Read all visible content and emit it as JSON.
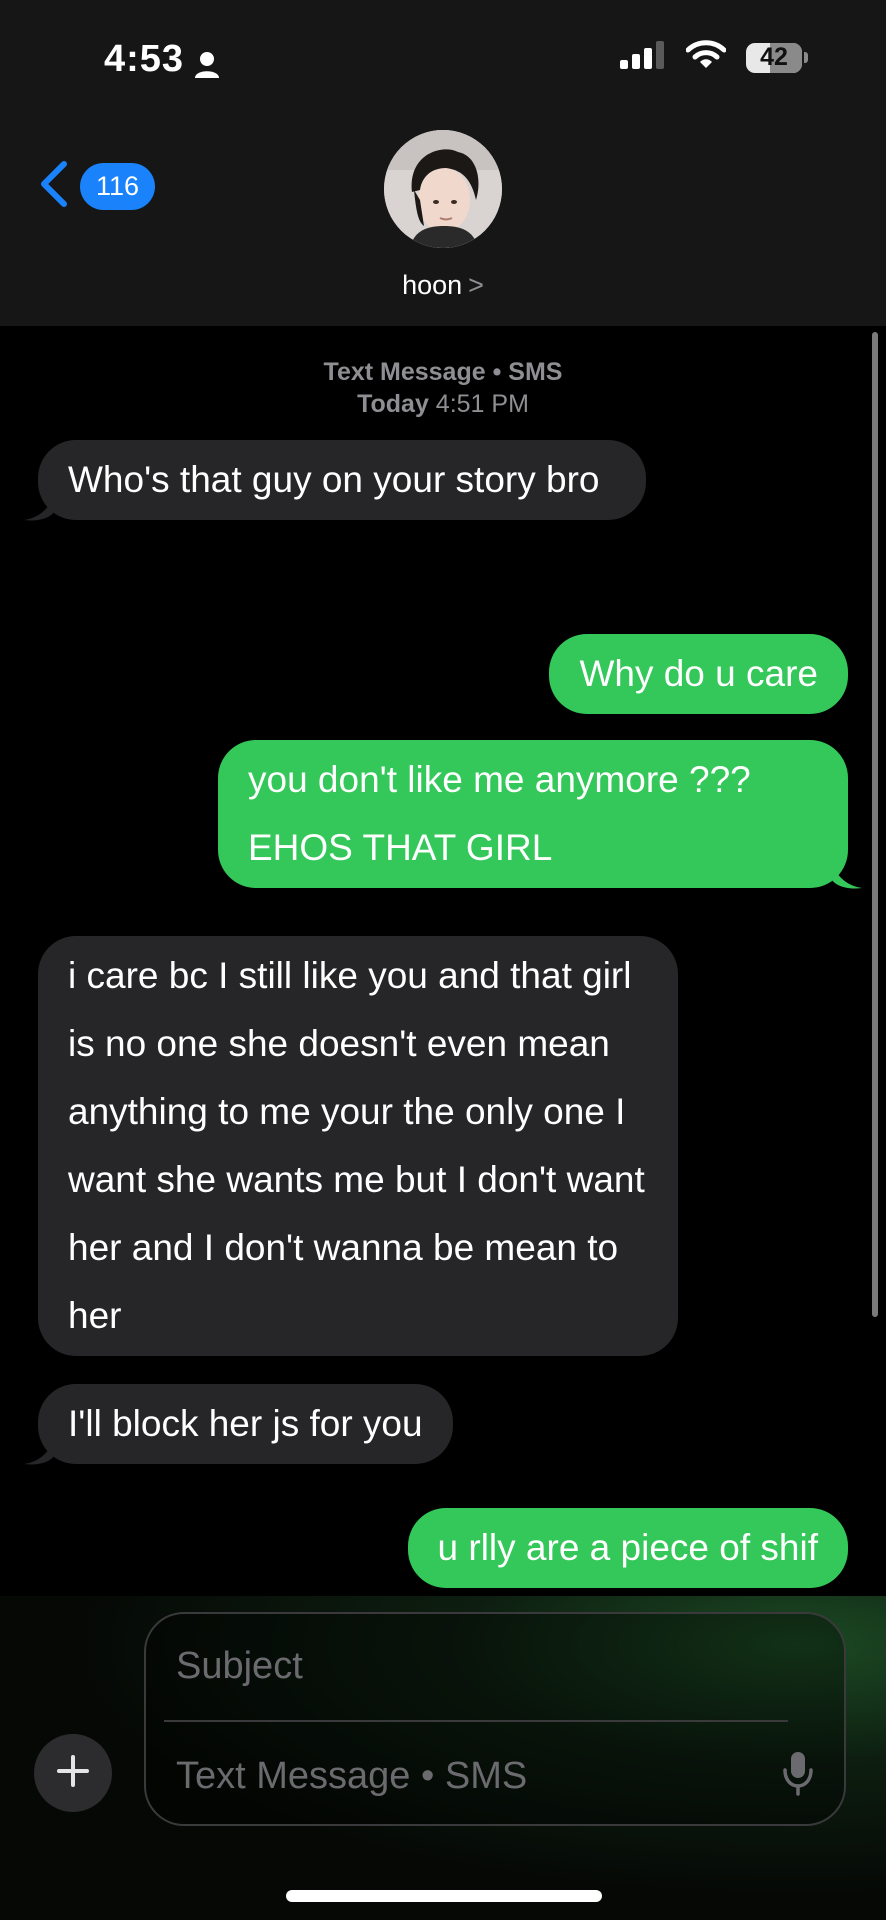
{
  "status_bar": {
    "time": "4:53",
    "battery": "42",
    "battery_level": 0.42
  },
  "nav": {
    "back_count": "116",
    "contact_name": "hoon",
    "contact_chevron": ">"
  },
  "conversation": {
    "service_label": "Text Message • SMS",
    "date_prefix": "Today",
    "date_time": "4:51 PM",
    "messages": [
      {
        "direction": "in",
        "text": "Who's that guy on your story bro"
      },
      {
        "direction": "out",
        "text": "Why do u care"
      },
      {
        "direction": "out",
        "text": "you don't like me anymore ??? EHOS THAT GIRL"
      },
      {
        "direction": "in",
        "text": "i care bc I still like you and that girl is no one she doesn't even mean anything to me your the only one I want she wants me but I don't want her and I don't wanna be mean to her"
      },
      {
        "direction": "in",
        "text": "I'll block her js for you"
      },
      {
        "direction": "out",
        "text": "u rlly are a piece of shif"
      }
    ]
  },
  "composer": {
    "subject_placeholder": "Subject",
    "message_placeholder": "Text Message • SMS"
  },
  "colors": {
    "sent_bubble": "#34c759",
    "received_bubble": "#262628",
    "accent_blue": "#1a82fb"
  },
  "icons": {
    "back": "chevron-left-icon",
    "person": "person-icon",
    "signal": "signal-icon",
    "wifi": "wifi-icon",
    "plus": "plus-icon",
    "mic": "microphone-icon"
  }
}
